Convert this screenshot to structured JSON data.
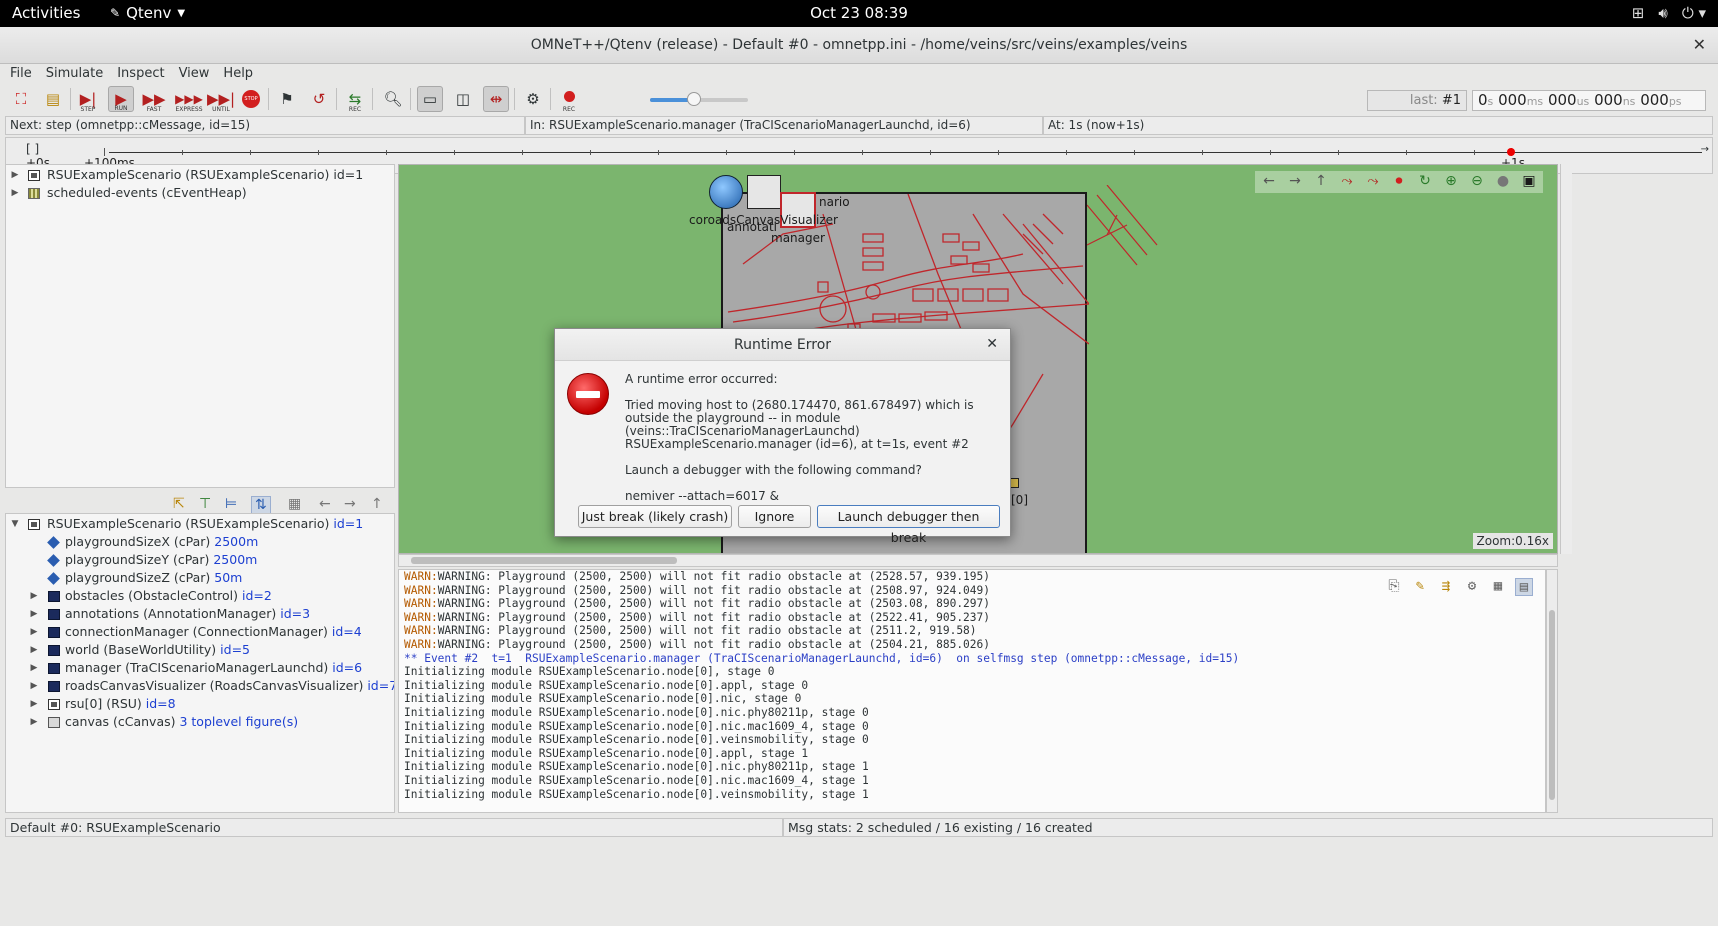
{
  "topbar": {
    "activities": "Activities",
    "app_name": "Qtenv",
    "clock": "Oct 23  08:39"
  },
  "window": {
    "title": "OMNeT++/Qtenv (release) - Default #0 - omnetpp.ini - /home/veins/src/veins/examples/veins"
  },
  "menu": [
    "File",
    "Simulate",
    "Inspect",
    "View",
    "Help"
  ],
  "toolbar": {
    "step_label": "STEP",
    "run_label": "RUN",
    "fast_label": "FAST",
    "express_label": "EXPRESS",
    "until_label": "UNTIL",
    "stop_label": "STOP",
    "rec_label": "REC",
    "rec2_label": "REC",
    "speed_fraction": 0.45,
    "last_event_prefix": "last:",
    "last_event": "#1",
    "time": {
      "s": "0",
      "ms": "000",
      "us": "000",
      "ns": "000",
      "ps": "000"
    },
    "units": {
      "s": "s",
      "ms": "ms",
      "us": "us",
      "ns": "ns",
      "ps": "ps"
    }
  },
  "status_strip": {
    "next": "Next: step (omnetpp::cMessage, id=15)",
    "in": "In: RSUExampleScenario.manager (TraCIScenarioManagerLaunchd, id=6)",
    "at": "At: 1s (now+1s)"
  },
  "timeline": {
    "label_start": "+0s",
    "label_100ms": "+100ms",
    "label_end": "+1s",
    "brackets": "[   ]"
  },
  "object_tree": [
    {
      "label": "RSUExampleScenario (RSUExampleScenario) ",
      "id": "id=1",
      "icon": "module-icon",
      "expandable": true
    },
    {
      "label": "scheduled-events (cEventHeap)",
      "id": "",
      "icon": "heap-icon",
      "expandable": true
    }
  ],
  "inspector_tree": {
    "root": {
      "label": "RSUExampleScenario (RSUExampleScenario) ",
      "id": "id=1"
    },
    "params": [
      {
        "label": "playgroundSizeX (cPar) ",
        "value": "2500m"
      },
      {
        "label": "playgroundSizeY (cPar) ",
        "value": "2500m"
      },
      {
        "label": "playgroundSizeZ (cPar) ",
        "value": "50m"
      }
    ],
    "children": [
      {
        "label": "obstacles (ObstacleControl) ",
        "id": "id=2",
        "icon": "box"
      },
      {
        "label": "annotations (AnnotationManager) ",
        "id": "id=3",
        "icon": "box"
      },
      {
        "label": "connectionManager (ConnectionManager) ",
        "id": "id=4",
        "icon": "box"
      },
      {
        "label": "world (BaseWorldUtility) ",
        "id": "id=5",
        "icon": "box"
      },
      {
        "label": "manager (TraCIScenarioManagerLaunchd) ",
        "id": "id=6",
        "icon": "box"
      },
      {
        "label": "roadsCanvasVisualizer (RoadsCanvasVisualizer) ",
        "id": "id=7",
        "icon": "box"
      },
      {
        "label": "rsu[0] (RSU) ",
        "id": "id=8",
        "icon": "module"
      },
      {
        "label": "canvas (cCanvas) ",
        "id": "3 toplevel figure(s)",
        "icon": "canvas"
      }
    ]
  },
  "network": {
    "labels": {
      "scenario_fragment": "nario",
      "overlap_text": "coroadsCanvasVisualizer",
      "annotations_fragment": "annotati",
      "manager": "manager",
      "rsu_fragment": "[0]"
    },
    "zoom": "Zoom:0.16x"
  },
  "log": [
    {
      "type": "warn",
      "tag": "WARN:",
      "text": "WARNING: Playground (2500, 2500) will not fit radio obstacle at (2528.57, 939.195)"
    },
    {
      "type": "warn",
      "tag": "WARN:",
      "text": "WARNING: Playground (2500, 2500) will not fit radio obstacle at (2508.97, 924.049)"
    },
    {
      "type": "warn",
      "tag": "WARN:",
      "text": "WARNING: Playground (2500, 2500) will not fit radio obstacle at (2503.08, 890.297)"
    },
    {
      "type": "warn",
      "tag": "WARN:",
      "text": "WARNING: Playground (2500, 2500) will not fit radio obstacle at (2522.41, 905.237)"
    },
    {
      "type": "warn",
      "tag": "WARN:",
      "text": "WARNING: Playground (2500, 2500) will not fit radio obstacle at (2511.2, 919.58)"
    },
    {
      "type": "warn",
      "tag": "WARN:",
      "text": "WARNING: Playground (2500, 2500) will not fit radio obstacle at (2504.21, 885.026)"
    },
    {
      "type": "event",
      "tag": "",
      "text": "** Event #2  t=1  RSUExampleScenario.manager (TraCIScenarioManagerLaunchd, id=6)  on selfmsg step (omnetpp::cMessage, id=15)"
    },
    {
      "type": "plain",
      "tag": "",
      "text": "Initializing module RSUExampleScenario.node[0], stage 0"
    },
    {
      "type": "plain",
      "tag": "",
      "text": "Initializing module RSUExampleScenario.node[0].appl, stage 0"
    },
    {
      "type": "plain",
      "tag": "",
      "text": "Initializing module RSUExampleScenario.node[0].nic, stage 0"
    },
    {
      "type": "plain",
      "tag": "",
      "text": "Initializing module RSUExampleScenario.node[0].nic.phy80211p, stage 0"
    },
    {
      "type": "plain",
      "tag": "",
      "text": "Initializing module RSUExampleScenario.node[0].nic.mac1609_4, stage 0"
    },
    {
      "type": "plain",
      "tag": "",
      "text": "Initializing module RSUExampleScenario.node[0].veinsmobility, stage 0"
    },
    {
      "type": "plain",
      "tag": "",
      "text": "Initializing module RSUExampleScenario.node[0].appl, stage 1"
    },
    {
      "type": "plain",
      "tag": "",
      "text": "Initializing module RSUExampleScenario.node[0].nic.phy80211p, stage 1"
    },
    {
      "type": "plain",
      "tag": "",
      "text": "Initializing module RSUExampleScenario.node[0].nic.mac1609_4, stage 1"
    },
    {
      "type": "plain",
      "tag": "",
      "text": "Initializing module RSUExampleScenario.node[0].veinsmobility, stage 1"
    }
  ],
  "statusbar": {
    "left": "Default #0: RSUExampleScenario",
    "right": "Msg stats: 2 scheduled / 16 existing / 16 created"
  },
  "dialog": {
    "title": "Runtime Error",
    "message": "A runtime error occurred:\n\nTried moving host to (2680.174470, 861.678497) which is outside the playground -- in module (veins::TraCIScenarioManagerLaunchd) RSUExampleScenario.manager (id=6), at t=1s, event #2\n\nLaunch a debugger with the following command?\n\nnemiver --attach=6017 &",
    "buttons": {
      "just_break": "Just break (likely crash)",
      "ignore": "Ignore",
      "launch": "Launch debugger then break"
    }
  },
  "colors": {
    "network_bg": "#7bb56e",
    "road": "#c0262b",
    "error": "#c40000",
    "id_blue": "#1c3fd1",
    "warn_tag": "#b45a00"
  }
}
